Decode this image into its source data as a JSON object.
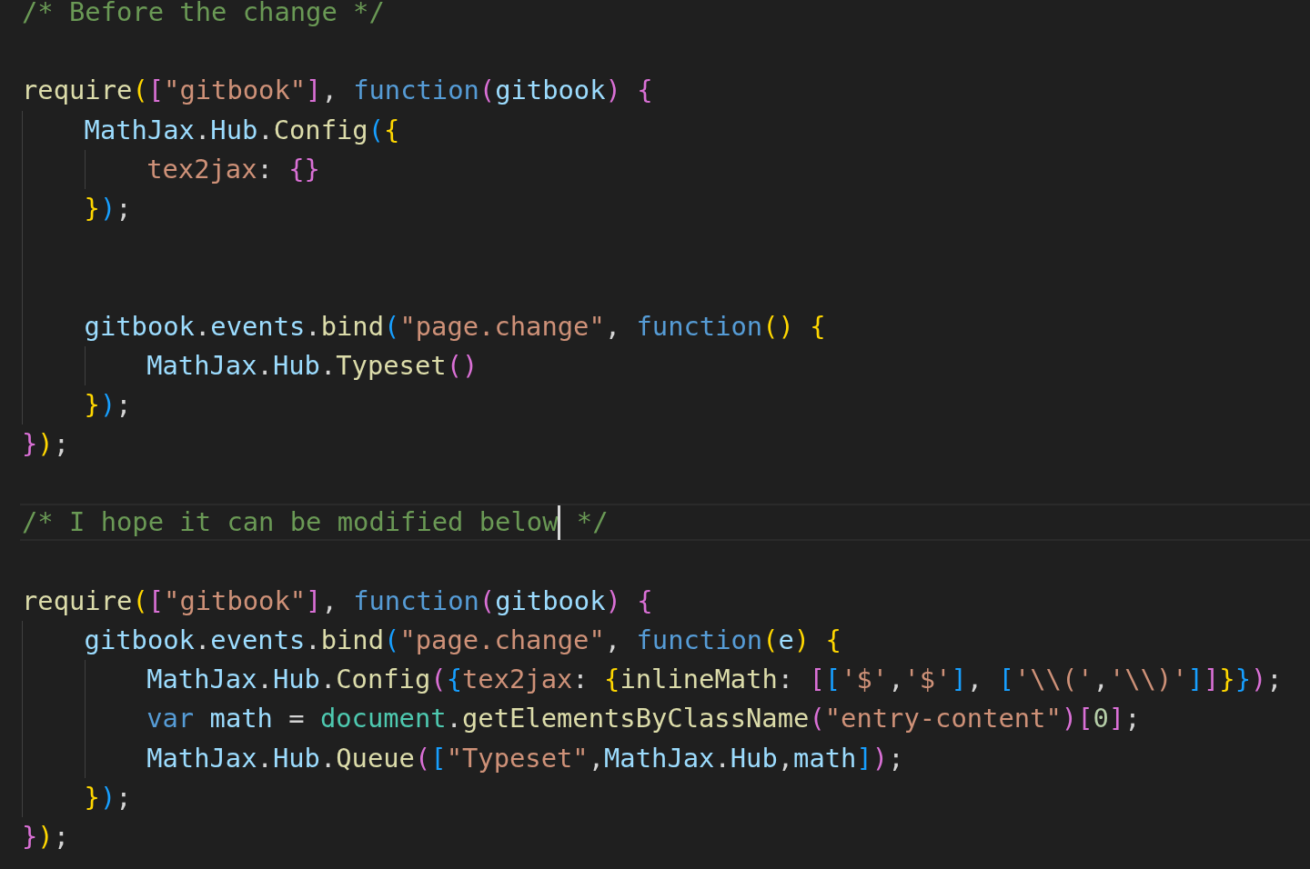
{
  "editor": {
    "lines": [
      {
        "tokens": [
          {
            "text": "/* Before the change */",
            "kind": "comment"
          }
        ]
      },
      {
        "kind": "blank"
      },
      {
        "tokens": [
          {
            "text": "require",
            "kind": "func"
          },
          {
            "text": "(",
            "kind": "b1"
          },
          {
            "text": "[",
            "kind": "b2"
          },
          {
            "text": "\"gitbook\"",
            "kind": "string"
          },
          {
            "text": "]",
            "kind": "b2"
          },
          {
            "text": ", ",
            "kind": "plain"
          },
          {
            "text": "function",
            "kind": "keyword"
          },
          {
            "text": "(",
            "kind": "b2"
          },
          {
            "text": "gitbook",
            "kind": "var"
          },
          {
            "text": ")",
            "kind": "b2"
          },
          {
            "text": " {",
            "kind": "b2"
          }
        ],
        "children": [
          {
            "tokens": [
              {
                "text": "MathJax",
                "kind": "var"
              },
              {
                "text": ".",
                "kind": "plain"
              },
              {
                "text": "Hub",
                "kind": "var"
              },
              {
                "text": ".",
                "kind": "plain"
              },
              {
                "text": "Config",
                "kind": "func"
              },
              {
                "text": "(",
                "kind": "b3"
              },
              {
                "text": "{",
                "kind": "b1"
              }
            ],
            "children": [
              {
                "tokens": [
                  {
                    "text": "tex2jax",
                    "kind": "string"
                  },
                  {
                    "text": ": ",
                    "kind": "plain"
                  },
                  {
                    "text": "{}",
                    "kind": "b2"
                  }
                ]
              }
            ]
          },
          {
            "tokens": [
              {
                "text": "}",
                "kind": "b1"
              },
              {
                "text": ")",
                "kind": "b3"
              },
              {
                "text": ";",
                "kind": "plain"
              }
            ]
          },
          {
            "kind": "blank"
          },
          {
            "kind": "blank"
          },
          {
            "tokens": [
              {
                "text": "gitbook",
                "kind": "var"
              },
              {
                "text": ".",
                "kind": "plain"
              },
              {
                "text": "events",
                "kind": "var"
              },
              {
                "text": ".",
                "kind": "plain"
              },
              {
                "text": "bind",
                "kind": "func"
              },
              {
                "text": "(",
                "kind": "b3"
              },
              {
                "text": "\"page.change\"",
                "kind": "string"
              },
              {
                "text": ", ",
                "kind": "plain"
              },
              {
                "text": "function",
                "kind": "keyword"
              },
              {
                "text": "()",
                "kind": "b1"
              },
              {
                "text": " {",
                "kind": "b1"
              }
            ],
            "children": [
              {
                "tokens": [
                  {
                    "text": "MathJax",
                    "kind": "var"
                  },
                  {
                    "text": ".",
                    "kind": "plain"
                  },
                  {
                    "text": "Hub",
                    "kind": "var"
                  },
                  {
                    "text": ".",
                    "kind": "plain"
                  },
                  {
                    "text": "Typeset",
                    "kind": "func"
                  },
                  {
                    "text": "()",
                    "kind": "b2"
                  }
                ]
              }
            ]
          },
          {
            "tokens": [
              {
                "text": "}",
                "kind": "b1"
              },
              {
                "text": ")",
                "kind": "b3"
              },
              {
                "text": ";",
                "kind": "plain"
              }
            ]
          }
        ]
      },
      {
        "tokens": [
          {
            "text": "}",
            "kind": "b2"
          },
          {
            "text": ")",
            "kind": "b1"
          },
          {
            "text": ";",
            "kind": "plain"
          }
        ]
      },
      {
        "kind": "blank"
      },
      {
        "current": true,
        "tokens": [
          {
            "text": "/* I hope it can be modified below",
            "kind": "comment"
          },
          {
            "kind": "cursor"
          },
          {
            "text": " */",
            "kind": "comment"
          }
        ]
      },
      {
        "kind": "blank"
      },
      {
        "tokens": [
          {
            "text": "require",
            "kind": "func"
          },
          {
            "text": "(",
            "kind": "b1"
          },
          {
            "text": "[",
            "kind": "b2"
          },
          {
            "text": "\"gitbook\"",
            "kind": "string"
          },
          {
            "text": "]",
            "kind": "b2"
          },
          {
            "text": ", ",
            "kind": "plain"
          },
          {
            "text": "function",
            "kind": "keyword"
          },
          {
            "text": "(",
            "kind": "b2"
          },
          {
            "text": "gitbook",
            "kind": "var"
          },
          {
            "text": ")",
            "kind": "b2"
          },
          {
            "text": " {",
            "kind": "b2"
          }
        ],
        "children": [
          {
            "tokens": [
              {
                "text": "gitbook",
                "kind": "var"
              },
              {
                "text": ".",
                "kind": "plain"
              },
              {
                "text": "events",
                "kind": "var"
              },
              {
                "text": ".",
                "kind": "plain"
              },
              {
                "text": "bind",
                "kind": "func"
              },
              {
                "text": "(",
                "kind": "b3"
              },
              {
                "text": "\"page.change\"",
                "kind": "string"
              },
              {
                "text": ", ",
                "kind": "plain"
              },
              {
                "text": "function",
                "kind": "keyword"
              },
              {
                "text": "(",
                "kind": "b1"
              },
              {
                "text": "e",
                "kind": "var"
              },
              {
                "text": ")",
                "kind": "b1"
              },
              {
                "text": " {",
                "kind": "b1"
              }
            ],
            "children": [
              {
                "tokens": [
                  {
                    "text": "MathJax",
                    "kind": "var"
                  },
                  {
                    "text": ".",
                    "kind": "plain"
                  },
                  {
                    "text": "Hub",
                    "kind": "var"
                  },
                  {
                    "text": ".",
                    "kind": "plain"
                  },
                  {
                    "text": "Config",
                    "kind": "func"
                  },
                  {
                    "text": "(",
                    "kind": "b2"
                  },
                  {
                    "text": "{",
                    "kind": "b3"
                  },
                  {
                    "text": "tex2jax",
                    "kind": "string"
                  },
                  {
                    "text": ": ",
                    "kind": "plain"
                  },
                  {
                    "text": "{",
                    "kind": "b1"
                  },
                  {
                    "text": "inlineMath",
                    "kind": "func"
                  },
                  {
                    "text": ": ",
                    "kind": "plain"
                  },
                  {
                    "text": "[",
                    "kind": "b2"
                  },
                  {
                    "text": "[",
                    "kind": "b3"
                  },
                  {
                    "text": "'$'",
                    "kind": "string"
                  },
                  {
                    "text": ",",
                    "kind": "plain"
                  },
                  {
                    "text": "'$'",
                    "kind": "string"
                  },
                  {
                    "text": "]",
                    "kind": "b3"
                  },
                  {
                    "text": ", ",
                    "kind": "plain"
                  },
                  {
                    "text": "[",
                    "kind": "b3"
                  },
                  {
                    "text": "'\\\\('",
                    "kind": "string"
                  },
                  {
                    "text": ",",
                    "kind": "plain"
                  },
                  {
                    "text": "'\\\\)'",
                    "kind": "string"
                  },
                  {
                    "text": "]",
                    "kind": "b3"
                  },
                  {
                    "text": "]",
                    "kind": "b2"
                  },
                  {
                    "text": "}",
                    "kind": "b1"
                  },
                  {
                    "text": "}",
                    "kind": "b3"
                  },
                  {
                    "text": ")",
                    "kind": "b2"
                  },
                  {
                    "text": ";",
                    "kind": "plain"
                  }
                ]
              },
              {
                "tokens": [
                  {
                    "text": "var",
                    "kind": "keyword"
                  },
                  {
                    "text": " math",
                    "kind": "var"
                  },
                  {
                    "text": " = ",
                    "kind": "plain"
                  },
                  {
                    "text": "document",
                    "kind": "type"
                  },
                  {
                    "text": ".",
                    "kind": "plain"
                  },
                  {
                    "text": "getElementsByClassName",
                    "kind": "func"
                  },
                  {
                    "text": "(",
                    "kind": "b2"
                  },
                  {
                    "text": "\"entry-content\"",
                    "kind": "string"
                  },
                  {
                    "text": ")",
                    "kind": "b2"
                  },
                  {
                    "text": "[",
                    "kind": "b2"
                  },
                  {
                    "text": "0",
                    "kind": "number"
                  },
                  {
                    "text": "]",
                    "kind": "b2"
                  },
                  {
                    "text": ";",
                    "kind": "plain"
                  }
                ]
              },
              {
                "tokens": [
                  {
                    "text": "MathJax",
                    "kind": "var"
                  },
                  {
                    "text": ".",
                    "kind": "plain"
                  },
                  {
                    "text": "Hub",
                    "kind": "var"
                  },
                  {
                    "text": ".",
                    "kind": "plain"
                  },
                  {
                    "text": "Queue",
                    "kind": "func"
                  },
                  {
                    "text": "(",
                    "kind": "b2"
                  },
                  {
                    "text": "[",
                    "kind": "b3"
                  },
                  {
                    "text": "\"Typeset\"",
                    "kind": "string"
                  },
                  {
                    "text": ",",
                    "kind": "plain"
                  },
                  {
                    "text": "MathJax",
                    "kind": "var"
                  },
                  {
                    "text": ".",
                    "kind": "plain"
                  },
                  {
                    "text": "Hub",
                    "kind": "var"
                  },
                  {
                    "text": ",",
                    "kind": "plain"
                  },
                  {
                    "text": "math",
                    "kind": "var"
                  },
                  {
                    "text": "]",
                    "kind": "b3"
                  },
                  {
                    "text": ")",
                    "kind": "b2"
                  },
                  {
                    "text": ";",
                    "kind": "plain"
                  }
                ]
              }
            ]
          },
          {
            "tokens": [
              {
                "text": "}",
                "kind": "b1"
              },
              {
                "text": ")",
                "kind": "b3"
              },
              {
                "text": ";",
                "kind": "plain"
              }
            ]
          }
        ]
      },
      {
        "tokens": [
          {
            "text": "}",
            "kind": "b2"
          },
          {
            "text": ")",
            "kind": "b1"
          },
          {
            "text": ";",
            "kind": "plain"
          }
        ]
      }
    ]
  }
}
